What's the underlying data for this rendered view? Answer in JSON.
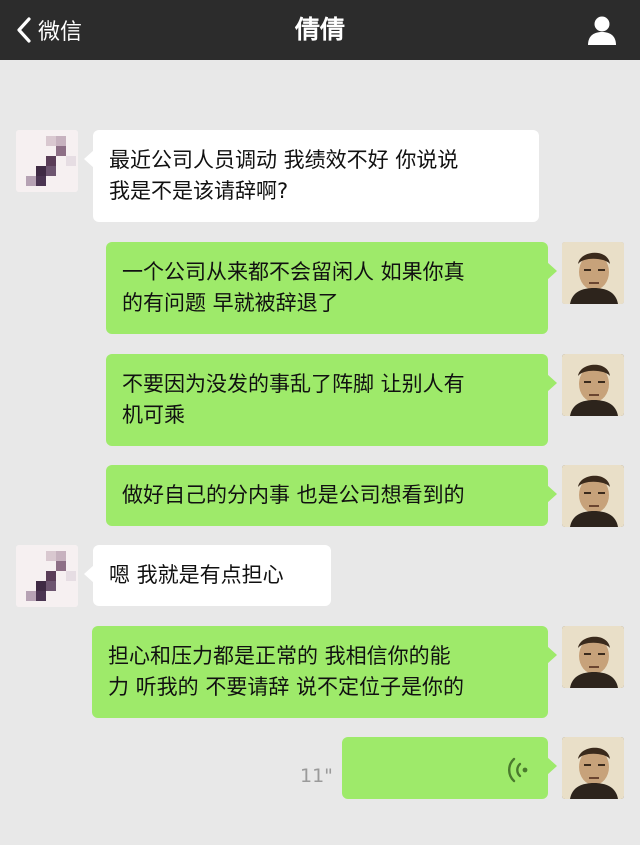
{
  "nav": {
    "back_label": "微信",
    "title": "倩倩"
  },
  "messages": [
    {
      "side": "in",
      "text": "最近公司人员调动 我绩效不好 你说说\n我是不是该请辞啊?"
    },
    {
      "side": "out",
      "text": "一个公司从来都不会留闲人 如果你真\n的有问题 早就被辞退了"
    },
    {
      "side": "out",
      "text": "不要因为没发的事乱了阵脚 让别人有\n机可乘"
    },
    {
      "side": "out",
      "text": "做好自己的分内事 也是公司想看到的"
    },
    {
      "side": "in",
      "text": "嗯 我就是有点担心"
    },
    {
      "side": "out",
      "text": "担心和压力都是正常的 我相信你的能\n力 听我的 不要请辞 说不定位子是你的"
    }
  ],
  "voice_message": {
    "side": "out",
    "duration": "11\""
  },
  "colors": {
    "navbar": "#2c2c2c",
    "chat_bg": "#e8e8e8",
    "bubble_out": "#9eea6a",
    "bubble_in": "#ffffff"
  }
}
